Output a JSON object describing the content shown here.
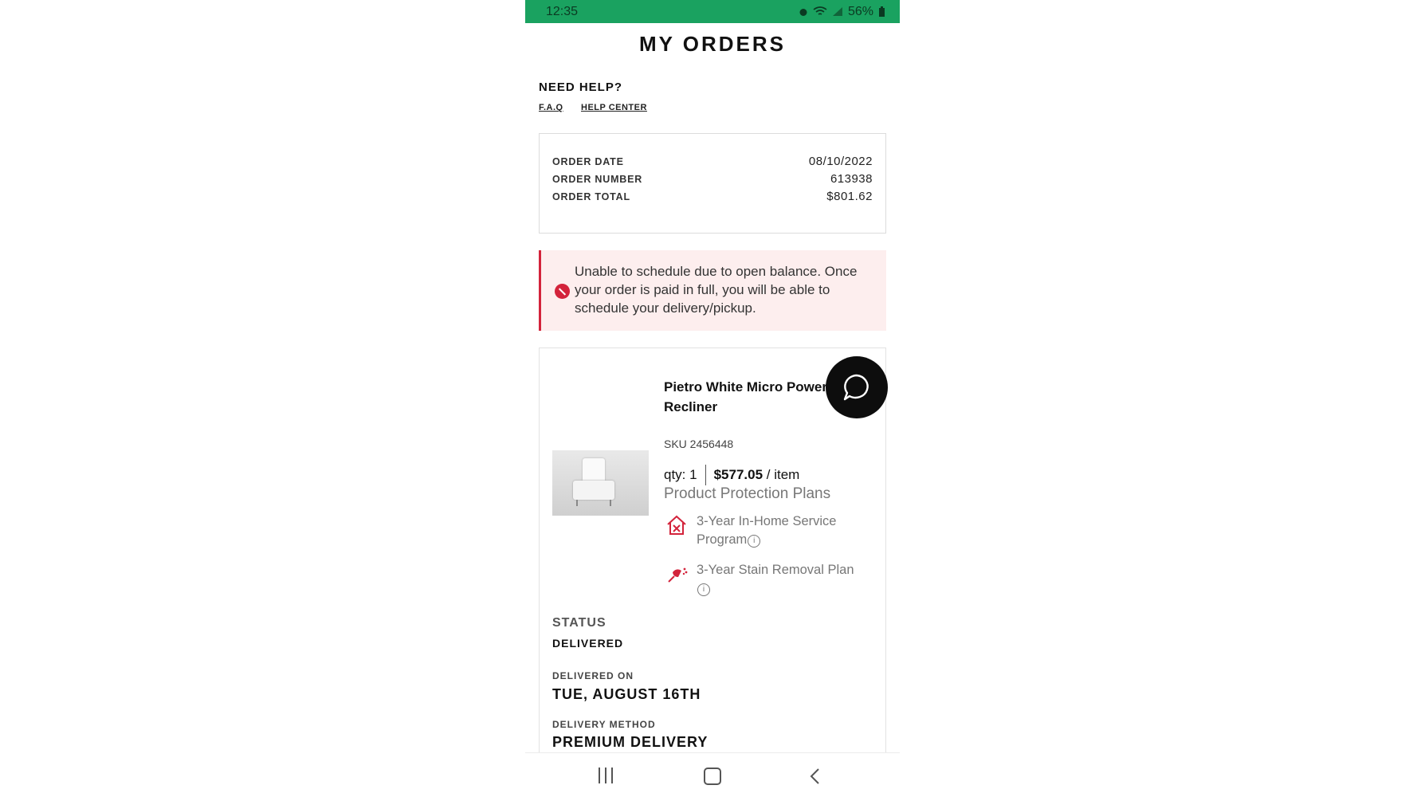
{
  "status_bar": {
    "time": "12:35",
    "battery": "56%"
  },
  "page": {
    "title": "MY ORDERS"
  },
  "help": {
    "heading": "NEED HELP?",
    "faq_label": "F.A.Q",
    "help_center_label": "HELP CENTER"
  },
  "order": {
    "date_label": "ORDER DATE",
    "date": "08/10/2022",
    "number_label": "ORDER NUMBER",
    "number": "613938",
    "total_label": "ORDER TOTAL",
    "total": "$801.62"
  },
  "alert": {
    "message": "Unable to schedule due to open balance. Once your order is paid in full, you will be able to schedule your delivery/pickup.",
    "color": "#d3233b"
  },
  "product": {
    "name": "Pietro White Micro Power Recliner",
    "sku": "SKU 2456448",
    "qty": "qty: 1",
    "price": "$577.05",
    "price_unit": " / item",
    "protection_title": "Product Protection Plans",
    "plans": [
      {
        "text": "3-Year In-Home Service Program",
        "icon": "house-service-icon"
      },
      {
        "text": "3-Year Stain Removal Plan",
        "icon": "stain-spray-icon"
      }
    ]
  },
  "status": {
    "label": "STATUS",
    "value": "DELIVERED",
    "delivered_label": "DELIVERED ON",
    "delivered_value": "TUE, AUGUST 16TH",
    "method_label": "DELIVERY METHOD",
    "method_value": "PREMIUM DELIVERY"
  },
  "colors": {
    "status_bar": "#1aa260",
    "accent_red": "#d3233b",
    "alert_bg": "#fdeeee"
  }
}
